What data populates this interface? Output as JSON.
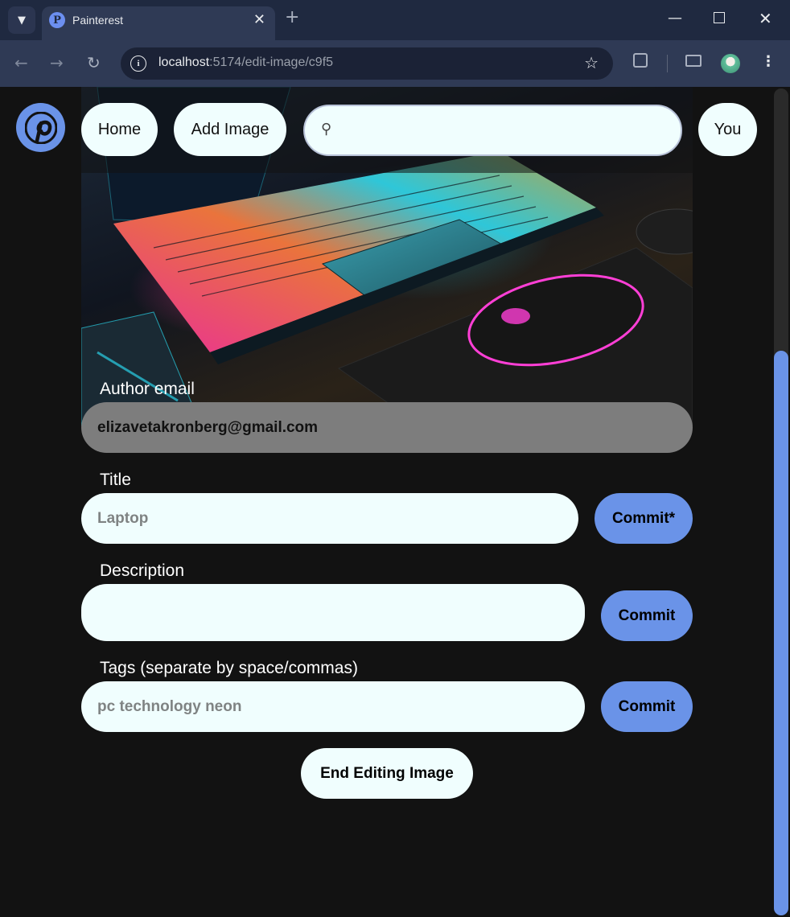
{
  "browser": {
    "tab_title": "Painterest",
    "url_host": "localhost",
    "url_path": ":5174/edit-image/c9f5"
  },
  "header": {
    "home_label": "Home",
    "add_image_label": "Add Image",
    "search_value": "",
    "you_label": "You"
  },
  "form": {
    "author_email_label": "Author email",
    "author_email_value": "elizavetakronberg@gmail.com",
    "title_label": "Title",
    "title_placeholder": "Laptop",
    "title_commit_label": "Commit*",
    "description_label": "Description",
    "description_value": "",
    "description_commit_label": "Commit",
    "tags_label": "Tags (separate by space/commas)",
    "tags_placeholder": "pc technology neon",
    "tags_commit_label": "Commit",
    "end_editing_label": "End Editing Image"
  },
  "colors": {
    "accent": "#6a93e8",
    "field_bg": "#f0fefe",
    "disabled_bg": "#7d7d7d",
    "page_bg": "#121212"
  },
  "icons": {
    "favicon": "pinterest-logo-icon",
    "search": "search-icon"
  }
}
